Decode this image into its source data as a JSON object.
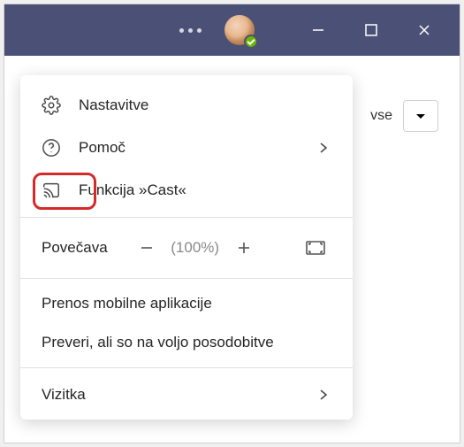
{
  "titlebar": {
    "ellipsis": "more",
    "presence": "available"
  },
  "topright": {
    "filter_label": "vse"
  },
  "menu": {
    "settings": "Nastavitve",
    "help": "Pomoč",
    "cast": "Funkcija »Cast«",
    "zoom_label": "Povečava",
    "zoom_value": "(100%)",
    "download_mobile": "Prenos mobilne aplikacije",
    "check_updates": "Preveri, ali so na voljo posodobitve",
    "about": "Vizitka"
  }
}
